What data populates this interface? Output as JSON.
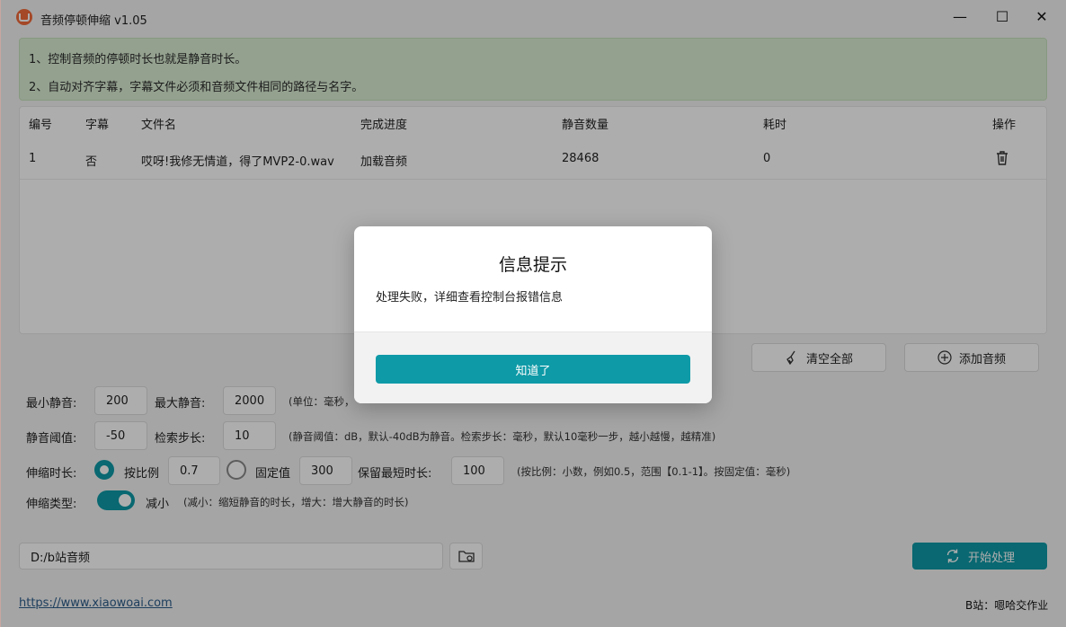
{
  "app": {
    "title": "音频停顿伸缩 v1.05"
  },
  "notice": {
    "line1": "1、控制音频的停顿时长也就是静音时长。",
    "line2": "2、自动对齐字幕，字幕文件必须和音频文件相同的路径与名字。"
  },
  "table": {
    "columns": [
      "编号",
      "字幕",
      "文件名",
      "完成进度",
      "静音数量",
      "耗时",
      "操作"
    ],
    "rows": [
      {
        "id": "1",
        "subtitle": "否",
        "filename": "哎呀!我修无情道，得了MVP2-0.wav",
        "progress": "加载音频",
        "silence_count": "28468",
        "time": "0",
        "action_icon": "trash-icon"
      }
    ]
  },
  "actions": {
    "clear_label": "清空全部",
    "add_label": "添加音频"
  },
  "settings": {
    "min_silence_label": "最小静音:",
    "min_silence_value": "200",
    "max_silence_label": "最大静音:",
    "max_silence_value": "2000",
    "silence_hint": "(单位：毫秒，",
    "threshold_label": "静音阈值:",
    "threshold_value": "-50",
    "step_label": "检索步长:",
    "step_value": "10",
    "threshold_hint": "(静音阈值：dB，默认-40dB为静音。检索步长：毫秒，默认10毫秒一步，越小越慢，越精准)",
    "stretch_label": "伸缩时长:",
    "ratio_label": "按比例",
    "ratio_value": "0.7",
    "fixed_label": "固定值",
    "fixed_value": "300",
    "keep_min_label": "保留最短时长:",
    "keep_min_value": "100",
    "stretch_hint": "(按比例：小数，例如0.5，范围【0.1-1】。按固定值：毫秒)",
    "type_label": "伸缩类型:",
    "type_value": "减小",
    "type_hint": "(减小：缩短静音的时长，增大：增大静音的时长)"
  },
  "path": {
    "value": "D:/b站音频"
  },
  "start_label": "开始处理",
  "footer": {
    "link": "https://www.xiaowoai.com",
    "right": "B站：嗯哈交作业"
  },
  "dialog": {
    "title": "信息提示",
    "message": "处理失败，详细查看控制台报错信息",
    "ok_label": "知道了"
  },
  "colors": {
    "accent": "#0e9aa7",
    "notice_bg": "#dbeed3"
  }
}
